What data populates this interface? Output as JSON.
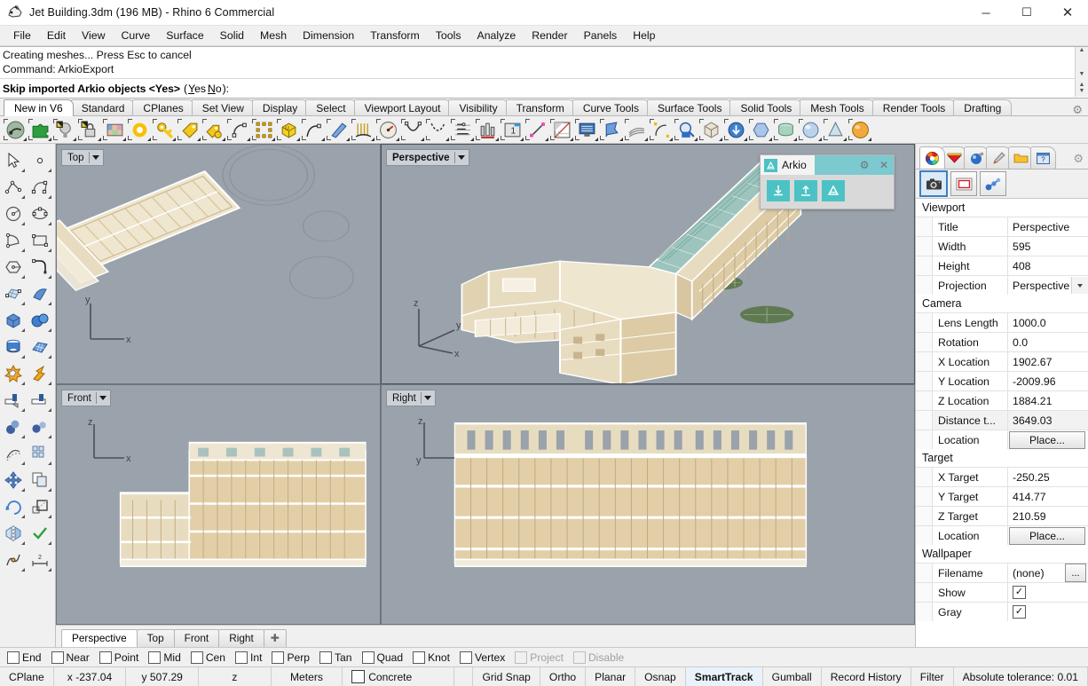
{
  "window": {
    "title": "Jet Building.3dm (196 MB) - Rhino 6 Commercial",
    "app_icon": "rhino-icon",
    "minimize": "─",
    "maximize": "☐",
    "close": "✕"
  },
  "menu": {
    "items": [
      "File",
      "Edit",
      "View",
      "Curve",
      "Surface",
      "Solid",
      "Mesh",
      "Dimension",
      "Transform",
      "Tools",
      "Analyze",
      "Render",
      "Panels",
      "Help"
    ]
  },
  "command": {
    "history": [
      "Creating meshes... Press Esc to cancel",
      "Command: ArkioExport"
    ],
    "prompt_label": "Skip imported Arkio objects <Yes>",
    "prompt_open": "(",
    "prompt_close": "):",
    "options": [
      "Yes",
      "No"
    ]
  },
  "toolbar_tabs": {
    "items": [
      "New in V6",
      "Standard",
      "CPlanes",
      "Set View",
      "Display",
      "Select",
      "Viewport Layout",
      "Visibility",
      "Transform",
      "Curve Tools",
      "Surface Tools",
      "Solid Tools",
      "Mesh Tools",
      "Render Tools",
      "Drafting"
    ],
    "active": "New in V6",
    "settings_icon": "gear-icon"
  },
  "main_toolbar": {
    "buttons": [
      {
        "name": "render-preview-icon"
      },
      {
        "name": "plugin-puzzle-icon"
      },
      {
        "name": "light-bulb-icon"
      },
      {
        "name": "lock-layer-icon"
      },
      {
        "name": "color-swatch-icon"
      },
      {
        "name": "ring-highlight-icon"
      },
      {
        "name": "key-icon"
      },
      {
        "name": "tag-icon"
      },
      {
        "name": "keys-tags-icon"
      },
      {
        "name": "arc-control-points-icon"
      },
      {
        "name": "point-grid-icon"
      },
      {
        "name": "uv-box-icon"
      },
      {
        "name": "curve-edit-icon"
      },
      {
        "name": "blue-plane-icon"
      },
      {
        "name": "comb-analysis-icon"
      },
      {
        "name": "gauge-icon"
      },
      {
        "name": "curve-v-icon"
      },
      {
        "name": "curve-dashed-icon"
      },
      {
        "name": "ordinate-dim-icon"
      },
      {
        "name": "bar-align-icon"
      },
      {
        "name": "detail-frame-icon"
      },
      {
        "name": "line-segment-icon"
      },
      {
        "name": "page-layout-icon"
      },
      {
        "name": "monitor-display-icon"
      },
      {
        "name": "flag-blue-icon"
      },
      {
        "name": "curvature-rays-icon"
      },
      {
        "name": "arc-point-icon"
      },
      {
        "name": "zoom-inspect-icon"
      },
      {
        "name": "cube-solid-icon"
      },
      {
        "name": "circle-down-icon"
      },
      {
        "name": "hexagon-blue-icon"
      },
      {
        "name": "cylinder-green-icon"
      },
      {
        "name": "sphere-shiny-icon"
      },
      {
        "name": "cone-flat-icon"
      },
      {
        "name": "sphere-orange-icon"
      }
    ]
  },
  "left_toolbar": {
    "buttons": [
      {
        "name": "select-arrow-icon"
      },
      {
        "name": "point-object-icon"
      },
      {
        "name": "polyline-icon"
      },
      {
        "name": "curve-cp-icon"
      },
      {
        "name": "circle-center-icon"
      },
      {
        "name": "ellipse-icon"
      },
      {
        "name": "arc-triangle-icon"
      },
      {
        "name": "rectangle-icon"
      },
      {
        "name": "polygon-icon"
      },
      {
        "name": "fillet-corner-icon"
      },
      {
        "name": "surface-cp-icon"
      },
      {
        "name": "surface-sweep-icon"
      },
      {
        "name": "box-solid-icon"
      },
      {
        "name": "sphere-solid-icon"
      },
      {
        "name": "cylinder-solid-icon"
      },
      {
        "name": "mesh-plane-icon"
      },
      {
        "name": "boolean-union-icon"
      },
      {
        "name": "explode-icon"
      },
      {
        "name": "trim-icon"
      },
      {
        "name": "split-icon"
      },
      {
        "name": "fillet-edge-icon"
      },
      {
        "name": "chamfer-edge-icon"
      },
      {
        "name": "offset-icon"
      },
      {
        "name": "array-icon"
      },
      {
        "name": "move-icon"
      },
      {
        "name": "copy-icon"
      },
      {
        "name": "rotate-icon"
      },
      {
        "name": "scale-icon"
      },
      {
        "name": "mirror-icon"
      },
      {
        "name": "check-object-icon"
      },
      {
        "name": "join-icon"
      },
      {
        "name": "dimension-icon"
      }
    ]
  },
  "viewports": [
    {
      "title": "Top",
      "active": false,
      "axes": [
        "y",
        "x"
      ]
    },
    {
      "title": "Perspective",
      "active": true,
      "axes": [
        "z",
        "y",
        "x"
      ]
    },
    {
      "title": "Front",
      "active": false,
      "axes": [
        "z",
        "x"
      ]
    },
    {
      "title": "Right",
      "active": false,
      "axes": [
        "z",
        "y"
      ]
    }
  ],
  "viewport_tabs": {
    "items": [
      "Perspective",
      "Top",
      "Front",
      "Right"
    ],
    "active": "Perspective",
    "add_label": "✚"
  },
  "arkio_panel": {
    "tab_label": "Arkio",
    "badge_icon": "arkio-logo-icon",
    "settings_icon": "gear-icon",
    "close_icon": "close-icon",
    "buttons": [
      {
        "name": "arkio-import-icon",
        "glyph": "⬇"
      },
      {
        "name": "arkio-export-icon",
        "glyph": "⬆"
      },
      {
        "name": "arkio-launch-icon",
        "glyph": "△"
      }
    ]
  },
  "properties_panel": {
    "tabs": [
      {
        "name": "tab-properties",
        "icon": "color-wheel-icon",
        "active": true
      },
      {
        "name": "tab-layers",
        "icon": "layers-icon",
        "active": false
      },
      {
        "name": "tab-materials",
        "icon": "material-sphere-icon",
        "active": false
      },
      {
        "name": "tab-display",
        "icon": "paintbrush-icon",
        "active": false
      },
      {
        "name": "tab-named-views",
        "icon": "folder-icon",
        "active": false
      },
      {
        "name": "tab-help",
        "icon": "help-window-icon",
        "active": false
      }
    ],
    "settings_icon": "gear-icon",
    "sub_buttons": [
      {
        "name": "viewport-properties-button",
        "icon": "camera-icon",
        "active": true
      },
      {
        "name": "frame-properties-button",
        "icon": "frame-icon",
        "active": false
      },
      {
        "name": "chain-properties-button",
        "icon": "linked-spheres-icon",
        "active": false
      }
    ],
    "sections": [
      {
        "title": "Viewport",
        "rows": [
          {
            "key": "Title",
            "value": "Perspective",
            "type": "text"
          },
          {
            "key": "Width",
            "value": "595",
            "type": "text"
          },
          {
            "key": "Height",
            "value": "408",
            "type": "text"
          },
          {
            "key": "Projection",
            "value": "Perspective",
            "type": "dropdown"
          }
        ]
      },
      {
        "title": "Camera",
        "rows": [
          {
            "key": "Lens Length",
            "value": "1000.0",
            "type": "text"
          },
          {
            "key": "Rotation",
            "value": "0.0",
            "type": "text"
          },
          {
            "key": "X Location",
            "value": "1902.67",
            "type": "text"
          },
          {
            "key": "Y Location",
            "value": "-2009.96",
            "type": "text"
          },
          {
            "key": "Z Location",
            "value": "1884.21",
            "type": "text"
          },
          {
            "key": "Distance t...",
            "value": "3649.03",
            "type": "text",
            "shade": true
          },
          {
            "key": "Location",
            "value": "Place...",
            "type": "button"
          }
        ]
      },
      {
        "title": "Target",
        "rows": [
          {
            "key": "X Target",
            "value": "-250.25",
            "type": "text"
          },
          {
            "key": "Y Target",
            "value": "414.77",
            "type": "text"
          },
          {
            "key": "Z Target",
            "value": "210.59",
            "type": "text"
          },
          {
            "key": "Location",
            "value": "Place...",
            "type": "button"
          }
        ]
      },
      {
        "title": "Wallpaper",
        "rows": [
          {
            "key": "Filename",
            "value": "(none)",
            "type": "file"
          },
          {
            "key": "Show",
            "value": "",
            "type": "checkbox",
            "checked": true
          },
          {
            "key": "Gray",
            "value": "",
            "type": "checkbox",
            "checked": true
          }
        ]
      }
    ]
  },
  "osnap_bar": {
    "items": [
      {
        "label": "End",
        "checked": false,
        "disabled": false
      },
      {
        "label": "Near",
        "checked": false,
        "disabled": false
      },
      {
        "label": "Point",
        "checked": false,
        "disabled": false
      },
      {
        "label": "Mid",
        "checked": false,
        "disabled": false
      },
      {
        "label": "Cen",
        "checked": false,
        "disabled": false
      },
      {
        "label": "Int",
        "checked": false,
        "disabled": false
      },
      {
        "label": "Perp",
        "checked": false,
        "disabled": false
      },
      {
        "label": "Tan",
        "checked": false,
        "disabled": false
      },
      {
        "label": "Quad",
        "checked": false,
        "disabled": false
      },
      {
        "label": "Knot",
        "checked": false,
        "disabled": false
      },
      {
        "label": "Vertex",
        "checked": false,
        "disabled": false
      },
      {
        "label": "Project",
        "checked": false,
        "disabled": true
      },
      {
        "label": "Disable",
        "checked": false,
        "disabled": true
      }
    ]
  },
  "status_bar": {
    "cplane": "CPlane",
    "x": "x -237.04",
    "y": "y 507.29",
    "z": "z",
    "units": "Meters",
    "layer": "Concrete",
    "toggles": [
      {
        "label": "Grid Snap",
        "on": false
      },
      {
        "label": "Ortho",
        "on": false
      },
      {
        "label": "Planar",
        "on": false
      },
      {
        "label": "Osnap",
        "on": false
      },
      {
        "label": "SmartTrack",
        "on": true
      },
      {
        "label": "Gumball",
        "on": false
      },
      {
        "label": "Record History",
        "on": false
      },
      {
        "label": "Filter",
        "on": false
      }
    ],
    "tolerance": "Absolute tolerance: 0.01"
  },
  "colors": {
    "viewport_bg": "#9aa2ab",
    "arkio_teal": "#4cc2c4",
    "building_tan": "#e2cfa8",
    "building_light": "#efe6cf",
    "roof_teal": "#9dc4bd",
    "tree_green": "#5f7a52"
  }
}
